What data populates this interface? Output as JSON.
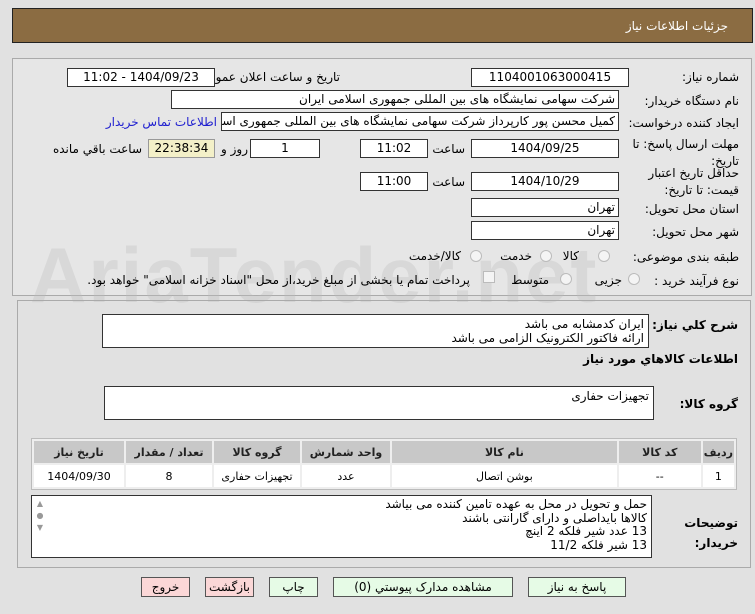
{
  "header": {
    "title": "جزئيات اطلاعات نیاز"
  },
  "watermark": "AriaTender.net",
  "form": {
    "need_number_label": "شماره نیاز:",
    "need_number": "1104001063000415",
    "announce_label": "تاریخ و ساعت اعلان عمومی:",
    "announce_value": "1404/09/23 - 11:02",
    "buyer_label": "نام دستگاه خریدار:",
    "buyer_value": "شرکت سهامی نمایشگاه های بین المللی جمهوری اسلامی ایران",
    "creator_label": "ایجاد کننده درخواست:",
    "creator_value": "کمیل محسن پور کارپرداز شرکت سهامی نمایشگاه های بین المللی جمهوری اسلامی ایران",
    "contact_link": "اطلاعات تماس خریدار",
    "deadline_label": "مهلت ارسال پاسخ: تا تاریخ:",
    "deadline_date": "1404/09/25",
    "time_label": "ساعت",
    "deadline_time": "11:02",
    "days": "1",
    "days_label": "روز و",
    "remaining": "22:38:34",
    "remaining_label": "ساعت باقي مانده",
    "validity_label": "حداقل تاریخ اعتبار قیمت: تا تاریخ:",
    "validity_date": "1404/10/29",
    "validity_time": "11:00",
    "province_label": "استان محل تحویل:",
    "province": "تهران",
    "city_label": "شهر محل تحویل:",
    "city": "تهران",
    "category_label": "طبقه بندی موضوعی:",
    "category_options": [
      "کالا",
      "خدمت",
      "کالا/خدمت"
    ],
    "category_selected": "کالا",
    "process_label": "نوع فرآیند خرید :",
    "process_options": [
      "جزیی",
      "متوسط"
    ],
    "process_selected": "جزیی",
    "payment_note": "پرداخت تمام یا بخشی از مبلغ خرید،از محل \"اسناد خزانه اسلامی\" خواهد بود."
  },
  "details": {
    "desc_label": "شرح کلي نیاز:",
    "desc_lines": [
      "ایران کدمشابه می باشد",
      "ارائه فاکتور الکترونیک الزامی می باشد"
    ],
    "goods_header": "اطلاعات کالاهاي مورد نیاز",
    "group_label": "گروه کالا:",
    "group_value": "تجهیزات حفاری",
    "table": {
      "headers": [
        "ردیف",
        "کد کالا",
        "نام کالا",
        "واحد شمارش",
        "گروه کالا",
        "تعداد / مقدار",
        "تاریخ نیاز"
      ],
      "rows": [
        [
          "1",
          "--",
          "بوشن اتصال",
          "عدد",
          "تجهیزات حفاری",
          "8",
          "1404/09/30"
        ]
      ]
    },
    "notes_label": "توضیحات خریدار:",
    "notes_lines": [
      "حمل و تحویل در محل به عهده تامین کننده می بیاشد",
      "کالاها بایداصلی و دارای گارانتی باشند",
      "13 عدد شیر فلکه 2 اینچ",
      "13 شیر فلکه 11/2"
    ]
  },
  "buttons": {
    "reply": "پاسخ به نیاز",
    "attachments": "مشاهده مدارک پیوستي (0)",
    "print": "چاپ",
    "back": "بازگشت",
    "exit": "خروج"
  }
}
